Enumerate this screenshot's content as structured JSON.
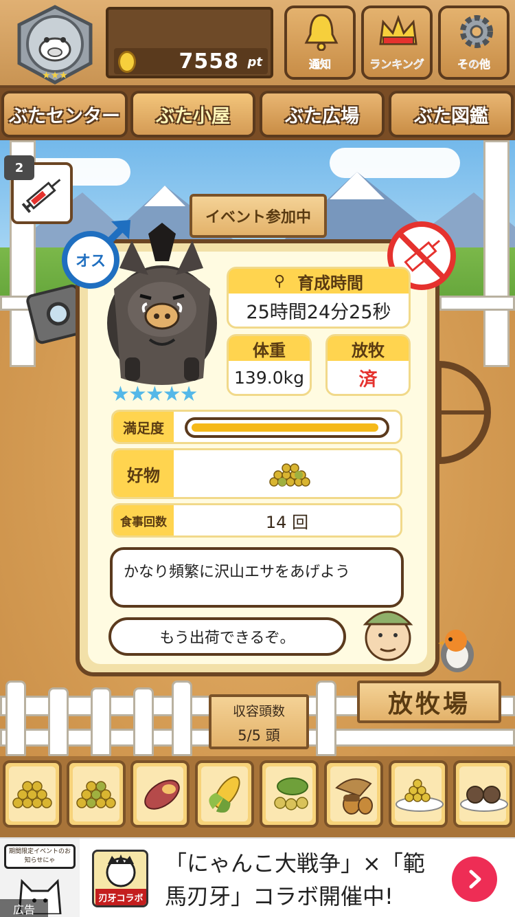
{
  "header": {
    "points_value": "7558",
    "points_unit": "pt",
    "buttons": [
      {
        "label": "通知",
        "icon": "bell-icon"
      },
      {
        "label": "ランキング",
        "icon": "crown-icon"
      },
      {
        "label": "その他",
        "icon": "gear-icon"
      }
    ]
  },
  "tabs": [
    {
      "label": "ぶたセンター",
      "active": false
    },
    {
      "label": "ぶた小屋",
      "active": true
    },
    {
      "label": "ぶた広場",
      "active": false
    },
    {
      "label": "ぶた図鑑",
      "active": false
    }
  ],
  "side": {
    "syringe_count": "2",
    "event_sign": "イベント参加中"
  },
  "pig": {
    "gender_label": "オス",
    "rating_stars": 5,
    "growth_time_label": "育成時間",
    "growth_time_value": "25時間24分25秒",
    "weight_label": "体重",
    "weight_value": "139.0kg",
    "grazing_label": "放牧",
    "grazing_value": "済",
    "satisfaction_label": "満足度",
    "satisfaction_level": 0.97,
    "favorite_label": "好物",
    "meal_count_label": "食事回数",
    "meal_count_value": "14 回",
    "advice_text": "かなり頻繁に沢山エサをあげよう",
    "status_text": "もう出荷できるぞ。"
  },
  "pen": {
    "capacity_label": "収容頭数",
    "capacity_value": "5/5 頭",
    "pasture_sign": "放牧場"
  },
  "food_items": [
    {
      "name": "grain-pile-icon"
    },
    {
      "name": "mixed-grain-icon"
    },
    {
      "name": "sweet-potato-icon"
    },
    {
      "name": "corn-icon"
    },
    {
      "name": "soybean-icon"
    },
    {
      "name": "acorn-icon"
    },
    {
      "name": "grain-plate-icon"
    },
    {
      "name": "rice-ball-plate-icon"
    }
  ],
  "ad": {
    "badge_text": "期間限定イベントのお知らせにゃ",
    "label": "広告",
    "collab_logo": "刃牙コラボ",
    "line1": "「にゃんこ大戦争」×「範",
    "line2": "馬刃牙」コラボ開催中!",
    "cta_icon": "chevron-right-icon"
  },
  "colors": {
    "accent_yellow": "#ffd44f",
    "wood_dark": "#6b4523",
    "star_blue": "#54b8e8",
    "male_blue": "#1f6fc0",
    "forbidden_red": "#e5322e"
  }
}
